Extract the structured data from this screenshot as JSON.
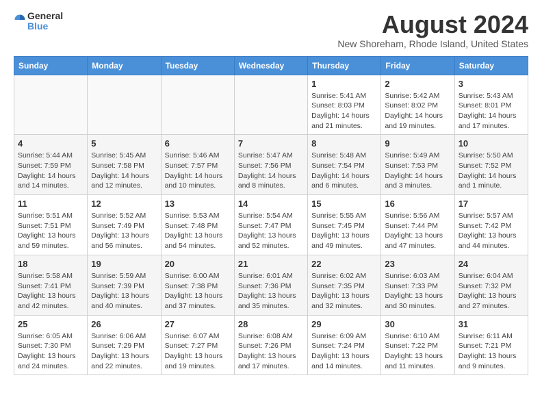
{
  "logo": {
    "general": "General",
    "blue": "Blue"
  },
  "title": "August 2024",
  "subtitle": "New Shoreham, Rhode Island, United States",
  "days_of_week": [
    "Sunday",
    "Monday",
    "Tuesday",
    "Wednesday",
    "Thursday",
    "Friday",
    "Saturday"
  ],
  "weeks": [
    [
      {
        "day": "",
        "info": ""
      },
      {
        "day": "",
        "info": ""
      },
      {
        "day": "",
        "info": ""
      },
      {
        "day": "",
        "info": ""
      },
      {
        "day": "1",
        "info": "Sunrise: 5:41 AM\nSunset: 8:03 PM\nDaylight: 14 hours\nand 21 minutes."
      },
      {
        "day": "2",
        "info": "Sunrise: 5:42 AM\nSunset: 8:02 PM\nDaylight: 14 hours\nand 19 minutes."
      },
      {
        "day": "3",
        "info": "Sunrise: 5:43 AM\nSunset: 8:01 PM\nDaylight: 14 hours\nand 17 minutes."
      }
    ],
    [
      {
        "day": "4",
        "info": "Sunrise: 5:44 AM\nSunset: 7:59 PM\nDaylight: 14 hours\nand 14 minutes."
      },
      {
        "day": "5",
        "info": "Sunrise: 5:45 AM\nSunset: 7:58 PM\nDaylight: 14 hours\nand 12 minutes."
      },
      {
        "day": "6",
        "info": "Sunrise: 5:46 AM\nSunset: 7:57 PM\nDaylight: 14 hours\nand 10 minutes."
      },
      {
        "day": "7",
        "info": "Sunrise: 5:47 AM\nSunset: 7:56 PM\nDaylight: 14 hours\nand 8 minutes."
      },
      {
        "day": "8",
        "info": "Sunrise: 5:48 AM\nSunset: 7:54 PM\nDaylight: 14 hours\nand 6 minutes."
      },
      {
        "day": "9",
        "info": "Sunrise: 5:49 AM\nSunset: 7:53 PM\nDaylight: 14 hours\nand 3 minutes."
      },
      {
        "day": "10",
        "info": "Sunrise: 5:50 AM\nSunset: 7:52 PM\nDaylight: 14 hours\nand 1 minute."
      }
    ],
    [
      {
        "day": "11",
        "info": "Sunrise: 5:51 AM\nSunset: 7:51 PM\nDaylight: 13 hours\nand 59 minutes."
      },
      {
        "day": "12",
        "info": "Sunrise: 5:52 AM\nSunset: 7:49 PM\nDaylight: 13 hours\nand 56 minutes."
      },
      {
        "day": "13",
        "info": "Sunrise: 5:53 AM\nSunset: 7:48 PM\nDaylight: 13 hours\nand 54 minutes."
      },
      {
        "day": "14",
        "info": "Sunrise: 5:54 AM\nSunset: 7:47 PM\nDaylight: 13 hours\nand 52 minutes."
      },
      {
        "day": "15",
        "info": "Sunrise: 5:55 AM\nSunset: 7:45 PM\nDaylight: 13 hours\nand 49 minutes."
      },
      {
        "day": "16",
        "info": "Sunrise: 5:56 AM\nSunset: 7:44 PM\nDaylight: 13 hours\nand 47 minutes."
      },
      {
        "day": "17",
        "info": "Sunrise: 5:57 AM\nSunset: 7:42 PM\nDaylight: 13 hours\nand 44 minutes."
      }
    ],
    [
      {
        "day": "18",
        "info": "Sunrise: 5:58 AM\nSunset: 7:41 PM\nDaylight: 13 hours\nand 42 minutes."
      },
      {
        "day": "19",
        "info": "Sunrise: 5:59 AM\nSunset: 7:39 PM\nDaylight: 13 hours\nand 40 minutes."
      },
      {
        "day": "20",
        "info": "Sunrise: 6:00 AM\nSunset: 7:38 PM\nDaylight: 13 hours\nand 37 minutes."
      },
      {
        "day": "21",
        "info": "Sunrise: 6:01 AM\nSunset: 7:36 PM\nDaylight: 13 hours\nand 35 minutes."
      },
      {
        "day": "22",
        "info": "Sunrise: 6:02 AM\nSunset: 7:35 PM\nDaylight: 13 hours\nand 32 minutes."
      },
      {
        "day": "23",
        "info": "Sunrise: 6:03 AM\nSunset: 7:33 PM\nDaylight: 13 hours\nand 30 minutes."
      },
      {
        "day": "24",
        "info": "Sunrise: 6:04 AM\nSunset: 7:32 PM\nDaylight: 13 hours\nand 27 minutes."
      }
    ],
    [
      {
        "day": "25",
        "info": "Sunrise: 6:05 AM\nSunset: 7:30 PM\nDaylight: 13 hours\nand 24 minutes."
      },
      {
        "day": "26",
        "info": "Sunrise: 6:06 AM\nSunset: 7:29 PM\nDaylight: 13 hours\nand 22 minutes."
      },
      {
        "day": "27",
        "info": "Sunrise: 6:07 AM\nSunset: 7:27 PM\nDaylight: 13 hours\nand 19 minutes."
      },
      {
        "day": "28",
        "info": "Sunrise: 6:08 AM\nSunset: 7:26 PM\nDaylight: 13 hours\nand 17 minutes."
      },
      {
        "day": "29",
        "info": "Sunrise: 6:09 AM\nSunset: 7:24 PM\nDaylight: 13 hours\nand 14 minutes."
      },
      {
        "day": "30",
        "info": "Sunrise: 6:10 AM\nSunset: 7:22 PM\nDaylight: 13 hours\nand 11 minutes."
      },
      {
        "day": "31",
        "info": "Sunrise: 6:11 AM\nSunset: 7:21 PM\nDaylight: 13 hours\nand 9 minutes."
      }
    ]
  ]
}
